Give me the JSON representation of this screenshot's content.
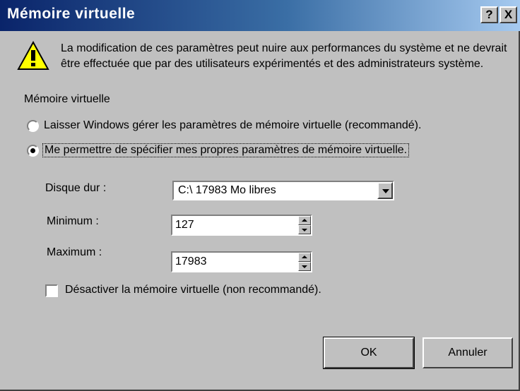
{
  "window": {
    "title": "Mémoire virtuelle",
    "help_label": "?",
    "close_label": "X"
  },
  "warning": {
    "icon": "warning-icon",
    "text": "La modification de ces paramètres peut nuire aux performances du système et ne devrait être effectuée que par des utilisateurs expérimentés et des administrateurs système."
  },
  "group": {
    "label": "Mémoire virtuelle"
  },
  "options": {
    "auto": {
      "label": "Laisser Windows gérer les paramètres de mémoire virtuelle (recommandé).",
      "selected": false
    },
    "manual": {
      "label": "Me permettre de spécifier mes propres paramètres de mémoire virtuelle.",
      "selected": true
    }
  },
  "disk": {
    "label": "Disque dur :",
    "value": "C:\\ 17983 Mo libres"
  },
  "minimum": {
    "label": "Minimum :",
    "value": "127"
  },
  "maximum": {
    "label": "Maximum :",
    "value": "17983"
  },
  "disable": {
    "label": "Désactiver la mémoire virtuelle (non recommandé).",
    "checked": false
  },
  "buttons": {
    "ok": "OK",
    "cancel": "Annuler"
  }
}
